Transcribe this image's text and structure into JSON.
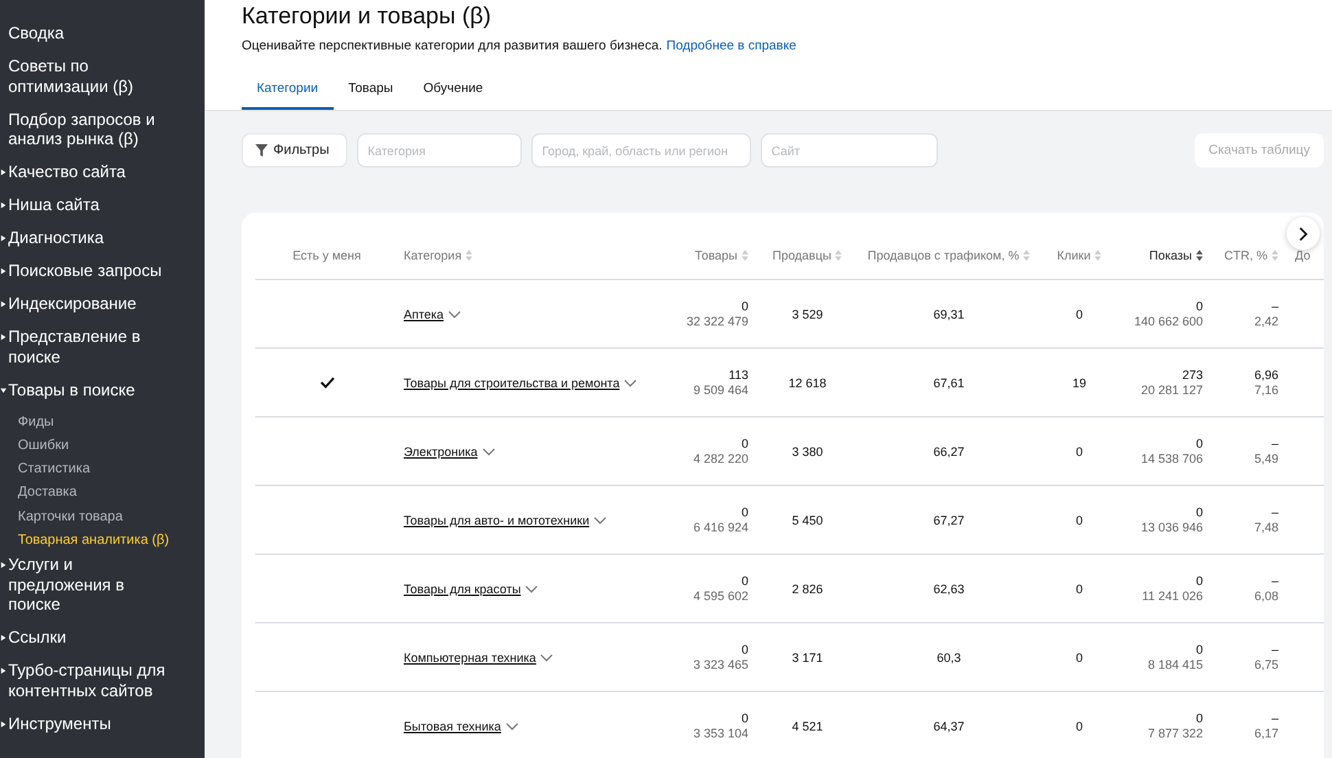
{
  "sidebar": {
    "items": [
      {
        "label": "Сводка"
      },
      {
        "label": "Советы по оптимизации (β)"
      },
      {
        "label": "Подбор запросов и анализ рынка (β)"
      },
      {
        "label": "Качество сайта",
        "expanded": false
      },
      {
        "label": "Ниша сайта",
        "expanded": false
      },
      {
        "label": "Диагностика",
        "expanded": false
      },
      {
        "label": "Поисковые запросы",
        "expanded": false
      },
      {
        "label": "Индексирование",
        "expanded": false
      },
      {
        "label": "Представление в поиске",
        "expanded": false
      },
      {
        "label": "Товары в поиске",
        "expanded": true,
        "children": [
          {
            "label": "Фиды",
            "selected": false
          },
          {
            "label": "Ошибки",
            "selected": false
          },
          {
            "label": "Статистика",
            "selected": false
          },
          {
            "label": "Доставка",
            "selected": false
          },
          {
            "label": "Карточки товара",
            "selected": false
          },
          {
            "label": "Товарная аналитика (β)",
            "selected": true
          }
        ]
      },
      {
        "label": "Услуги и предложения в поиске",
        "expanded": false
      },
      {
        "label": "Ссылки",
        "expanded": false
      },
      {
        "label": "Турбо-страницы для контентных сайтов",
        "expanded": false
      },
      {
        "label": "Инструменты",
        "expanded": false
      }
    ]
  },
  "page": {
    "title": "Категории и товары (β)",
    "subtitle": "Оценивайте перспективные категории для развития вашего бизнеса.",
    "help_link": "Подробнее в справке"
  },
  "tabs": [
    {
      "label": "Категории",
      "selected": true
    },
    {
      "label": "Товары",
      "selected": false
    },
    {
      "label": "Обучение",
      "selected": false
    }
  ],
  "filters": {
    "button": "Фильтры",
    "fields": [
      {
        "placeholder": "Категория"
      },
      {
        "placeholder": "Город, край, область или регион"
      },
      {
        "placeholder": "Сайт"
      }
    ],
    "download": "Скачать таблицу",
    "download_disabled": true
  },
  "table": {
    "columns": [
      {
        "label": "Есть у меня"
      },
      {
        "label": "Категория",
        "sorted": false
      },
      {
        "label": "Товары",
        "sorted": false
      },
      {
        "label": "Продавцы",
        "sorted": false
      },
      {
        "label": "Продавцов с трафиком, %",
        "sorted": false
      },
      {
        "label": "Клики",
        "sorted": false
      },
      {
        "label": "Показы",
        "sorted": true
      },
      {
        "label": "CTR, %",
        "sorted": false
      },
      {
        "label": "До"
      }
    ],
    "rows": [
      {
        "have": false,
        "category": "Аптека",
        "goods": [
          "0",
          "32 322 479"
        ],
        "sellers": "3 529",
        "traffic": "69,31",
        "clicks": "0",
        "shows": [
          "0",
          "140 662 600"
        ],
        "ctr": [
          "–",
          "2,42"
        ]
      },
      {
        "have": true,
        "category": "Товары для строительства и ремонта",
        "goods": [
          "113",
          "9 509 464"
        ],
        "sellers": "12 618",
        "traffic": "67,61",
        "clicks": "19",
        "shows": [
          "273",
          "20 281 127"
        ],
        "ctr": [
          "6,96",
          "7,16"
        ]
      },
      {
        "have": false,
        "category": "Электроника",
        "goods": [
          "0",
          "4 282 220"
        ],
        "sellers": "3 380",
        "traffic": "66,27",
        "clicks": "0",
        "shows": [
          "0",
          "14 538 706"
        ],
        "ctr": [
          "–",
          "5,49"
        ]
      },
      {
        "have": false,
        "category": "Товары для авто- и мототехники",
        "goods": [
          "0",
          "6 416 924"
        ],
        "sellers": "5 450",
        "traffic": "67,27",
        "clicks": "0",
        "shows": [
          "0",
          "13 036 946"
        ],
        "ctr": [
          "–",
          "7,48"
        ]
      },
      {
        "have": false,
        "category": "Товары для красоты",
        "goods": [
          "0",
          "4 595 602"
        ],
        "sellers": "2 826",
        "traffic": "62,63",
        "clicks": "0",
        "shows": [
          "0",
          "11 241 026"
        ],
        "ctr": [
          "–",
          "6,08"
        ]
      },
      {
        "have": false,
        "category": "Компьютерная техника",
        "goods": [
          "0",
          "3 323 465"
        ],
        "sellers": "3 171",
        "traffic": "60,3",
        "clicks": "0",
        "shows": [
          "0",
          "8 184 415"
        ],
        "ctr": [
          "–",
          "6,75"
        ]
      },
      {
        "have": false,
        "category": "Бытовая техника",
        "goods": [
          "0",
          "3 353 104"
        ],
        "sellers": "4 521",
        "traffic": "64,37",
        "clicks": "0",
        "shows": [
          "0",
          "7 877 322"
        ],
        "ctr": [
          "–",
          "6,17"
        ]
      }
    ]
  }
}
